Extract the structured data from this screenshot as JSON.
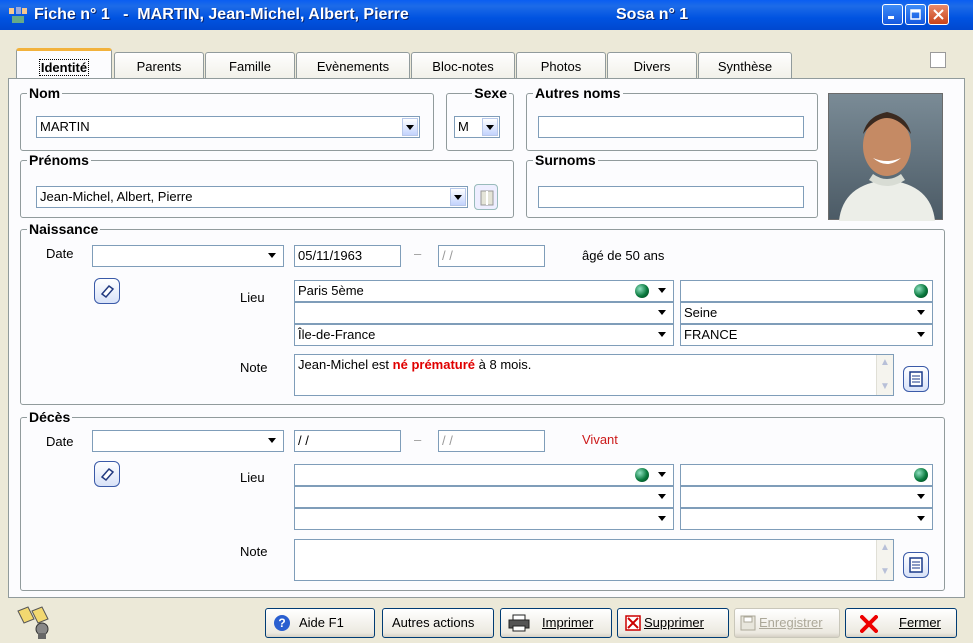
{
  "window": {
    "title_left": "Fiche n° 1   -  MARTIN, Jean-Michel, Albert, Pierre",
    "title_right": "Sosa n° 1"
  },
  "tabs": [
    {
      "label": "Identité",
      "active": true
    },
    {
      "label": "Parents"
    },
    {
      "label": "Famille"
    },
    {
      "label": "Evènements"
    },
    {
      "label": "Bloc-notes"
    },
    {
      "label": "Photos"
    },
    {
      "label": "Divers"
    },
    {
      "label": "Synthèse"
    }
  ],
  "identite": {
    "nom_legend": "Nom",
    "nom_value": "MARTIN",
    "sexe_legend": "Sexe",
    "sexe_value": "M",
    "autres_noms_legend": "Autres noms",
    "autres_noms_value": "",
    "prenoms_legend": "Prénoms",
    "prenoms_value": "Jean-Michel, Albert, Pierre",
    "surnoms_legend": "Surnoms",
    "surnoms_value": ""
  },
  "naissance": {
    "legend": "Naissance",
    "date_label": "Date",
    "date_qualifier": "",
    "date1": "05/11/1963",
    "date_sep": "–",
    "date2": " /  / ",
    "age_text": "âgé de 50 ans",
    "lieu_label": "Lieu",
    "lieu_ville": "Paris 5ème",
    "lieu_row2": "",
    "lieu_region": "Île-de-France",
    "lieu_right1": "",
    "lieu_departement": "Seine",
    "lieu_pays": "FRANCE",
    "note_label": "Note",
    "note_before": "Jean-Michel est ",
    "note_bold": "né prématuré",
    "note_after": " à 8 mois.",
    "note_bold_color": "#e00000"
  },
  "deces": {
    "legend": "Décès",
    "date_label": "Date",
    "date_qualifier": "",
    "date1": " /  / ",
    "date_sep": "–",
    "date2": " /  / ",
    "status_text": "Vivant",
    "status_color": "#cc1a1a",
    "lieu_label": "Lieu",
    "note_label": "Note"
  },
  "buttons": {
    "aide": "Aide   F1",
    "autres_actions": "Autres actions",
    "imprimer": "Imprimer",
    "supprimer": "Supprimer",
    "enregistrer": "Enregistrer",
    "fermer": "Fermer"
  },
  "icons": {
    "app": "family-tree-icon",
    "help": "question-icon",
    "print": "printer-icon",
    "delete": "delete-icon",
    "save": "floppy-icon",
    "close": "red-x-icon",
    "bottom_left": "binoculars-icon"
  },
  "colors": {
    "titlebar": "#0054e3",
    "accent_tab": "#f2b23c"
  }
}
